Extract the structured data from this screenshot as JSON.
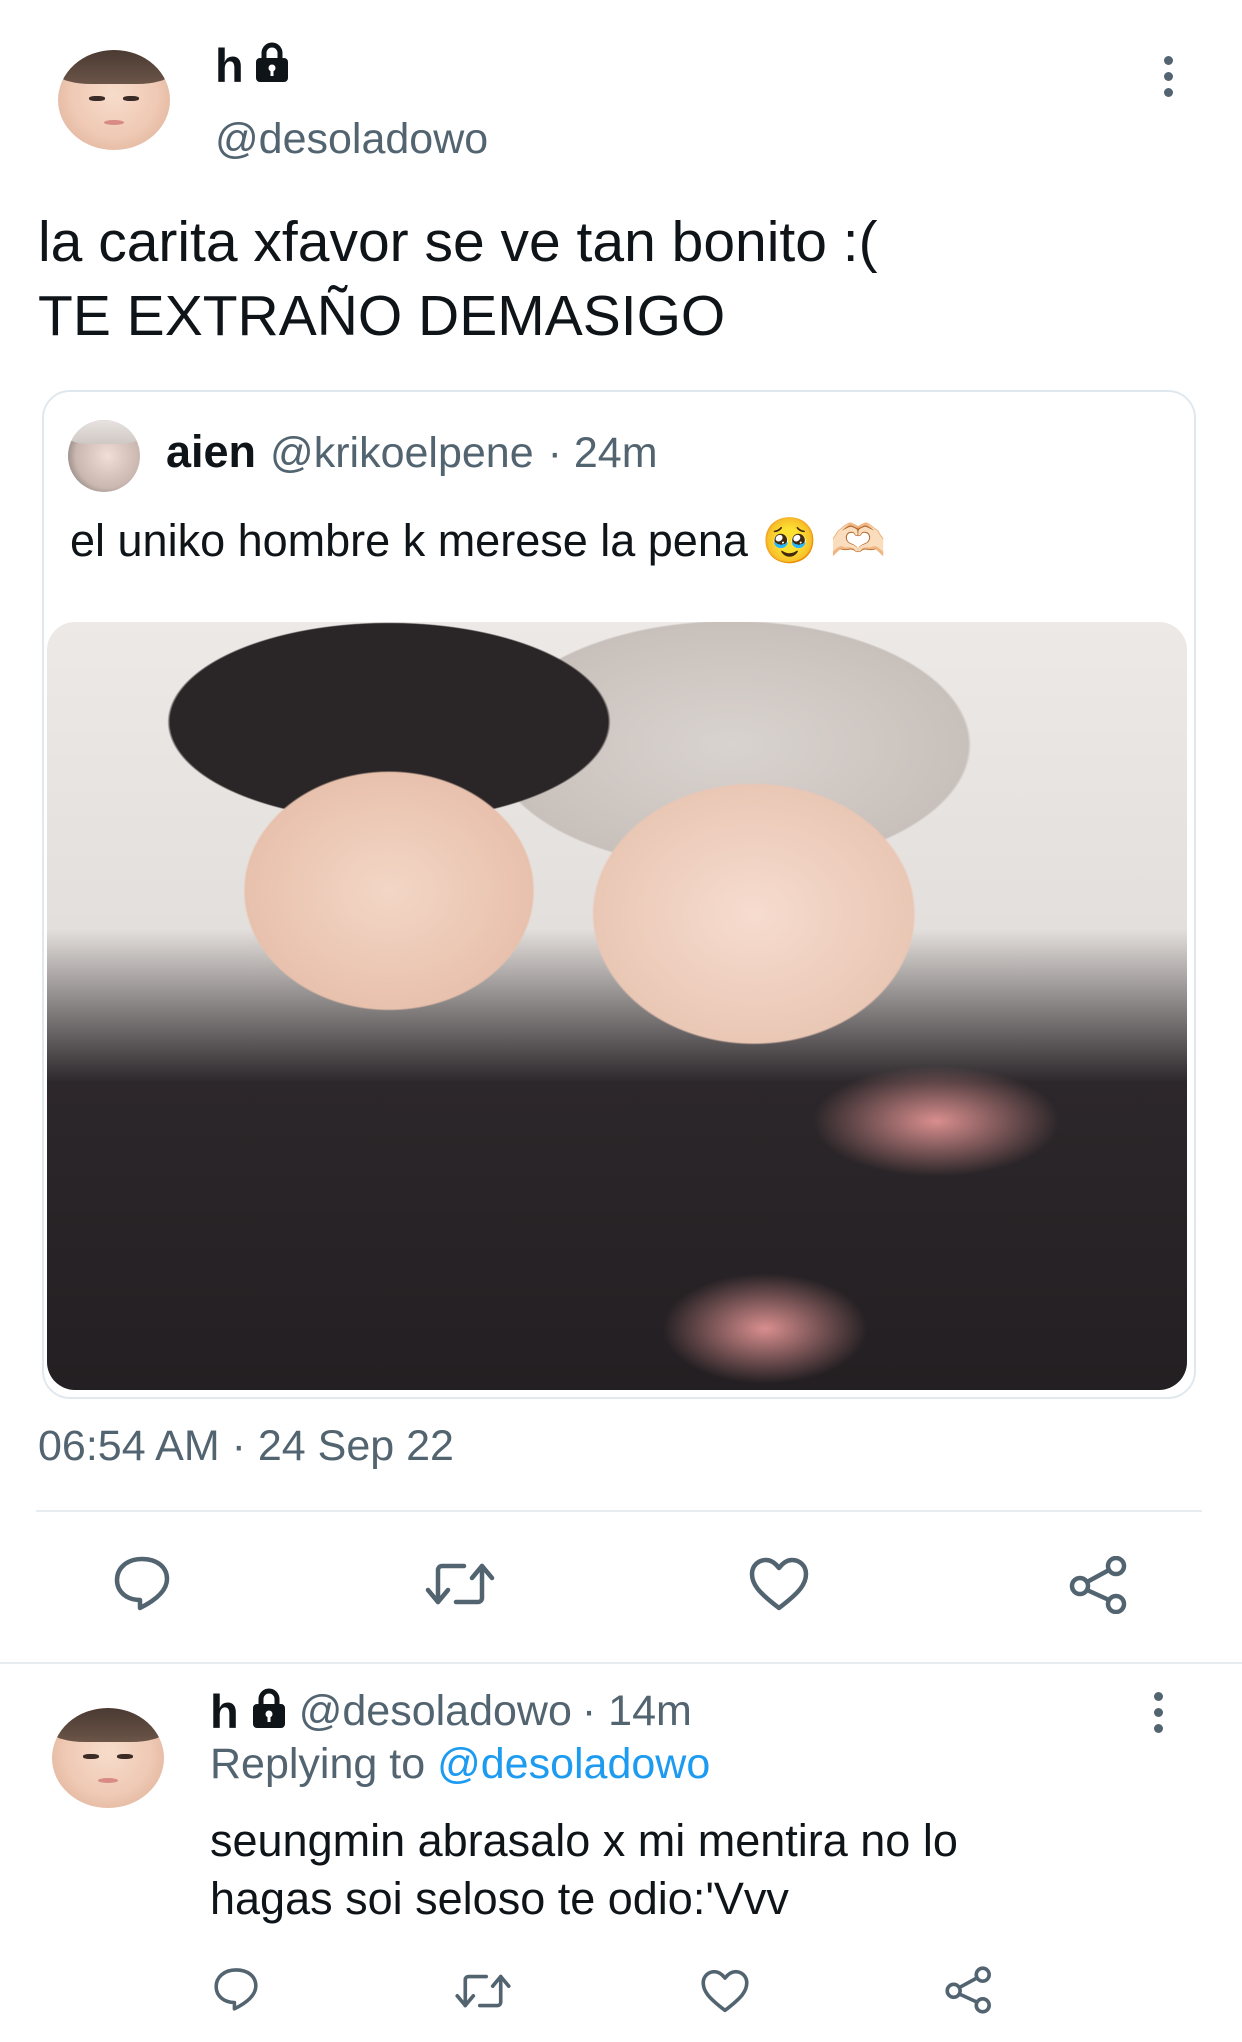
{
  "main_tweet": {
    "display_name": "h",
    "handle": "@desoladowo",
    "text_line1": "la carita xfavor se ve tan bonito :(",
    "text_line2": "TE EXTRAÑO DEMASIGO",
    "timestamp": "06:54 AM · 24 Sep 22"
  },
  "quoted_tweet": {
    "display_name": "aien",
    "handle": "@krikoelpene",
    "time": "· 24m",
    "text": "el uniko hombre k merese la pena",
    "emojis": "🥹 🫶🏻"
  },
  "reply": {
    "display_name": "h",
    "handle": "@desoladowo",
    "time": "· 14m",
    "replying_prefix": "Replying to",
    "replying_to": "@desoladowo",
    "text_line1": "seungmin abrasalo x mi mentira no lo",
    "text_line2": "hagas soi seloso te odio:'Vvv"
  },
  "icons": {
    "lock": "lock-icon",
    "more": "more-options-icon",
    "reply": "reply-icon",
    "retweet": "retweet-icon",
    "like": "heart-icon",
    "share": "share-icon"
  },
  "colors": {
    "text": "#0f1419",
    "secondary": "#536471",
    "link": "#1d9bf0",
    "divider": "#e6ecf0"
  }
}
